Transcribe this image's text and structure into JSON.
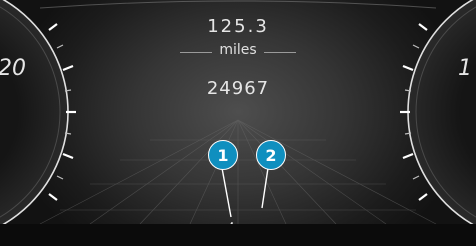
{
  "trip": {
    "value": "125.3",
    "unit": "miles"
  },
  "odometer": {
    "value": "24967"
  },
  "gauges": {
    "left": {
      "partial_label": "20"
    },
    "right": {
      "partial_label": "1"
    }
  },
  "callouts": [
    {
      "label": "1"
    },
    {
      "label": "2"
    }
  ],
  "status_icons": [
    {
      "icon": "lane-keeping-assist-off-icon"
    },
    {
      "icon": "vehicle-ahead-detected-icon"
    }
  ],
  "colors": {
    "callout": "#0f8fbf",
    "text": "#e6e6e6",
    "background": "#1c1c1c"
  }
}
